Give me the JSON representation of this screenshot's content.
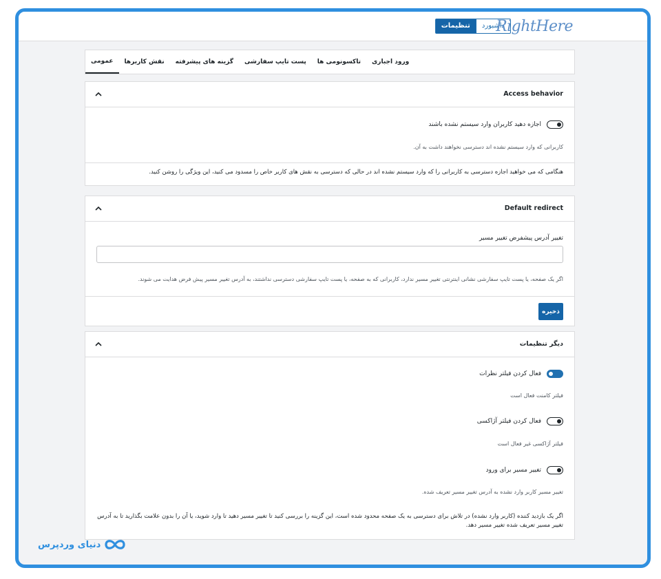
{
  "header": {
    "brand": "RightHere",
    "buttons": [
      {
        "label": "تنظیمات",
        "active": true
      },
      {
        "label": "داشبورد",
        "active": false
      }
    ]
  },
  "tabs": [
    {
      "label": "عمومی",
      "active": true
    },
    {
      "label": "نقش کاربرها",
      "active": false
    },
    {
      "label": "گزینه های پیشرفته",
      "active": false
    },
    {
      "label": "پست تایپ سفارشی",
      "active": false
    },
    {
      "label": "تاکسونومی ها",
      "active": false
    },
    {
      "label": "ورود اجباری",
      "active": false
    }
  ],
  "access_behavior": {
    "title": "Access behavior",
    "toggle_label": "اجازه دهید کاربران وارد سیستم نشده باشند",
    "toggle_on": false,
    "description": "کاربرانی که وارد سیستم نشده اند دسترسی نخواهند داشت به آن.",
    "note": "هنگامی که می خواهید اجازه دسترسی به کاربرانی را که وارد سیستم نشده اند در حالی که دسترسی به نقش های کاربر خاص را مسدود می کنید، این ویژگی را روشن کنید."
  },
  "default_redirect": {
    "title": "Default redirect",
    "field_label": "تغییر آدرس پیشفرض تغییر مسیر",
    "field_value": "",
    "note": "اگر یک صفحه، یا پست تایپ سفارشی نشانی اینترنتی تغییر مسیر ندارد، کاربرانی که به صفحه، یا پست تایپ سفارشی دسترسی نداشتند، به آدرس تغییر مسیر پیش فرض هدایت می شوند.",
    "save_label": "ذخیره"
  },
  "other_settings": {
    "title": "دیگر تنظیمات",
    "items": [
      {
        "label": "فعال کردن فیلتر نظرات",
        "on": true,
        "description": "فیلتر کامنت فعال است"
      },
      {
        "label": "فعال کردن فیلتر آژاکسی",
        "on": false,
        "description": "فیلتر آژاکسی غیر فعال است"
      },
      {
        "label": "تغییر مسیر برای ورود",
        "on": false,
        "description": "تغییر مسیر کاربر وارد نشده به آدرس تغییر مسیر تعریف شده."
      }
    ],
    "note": "اگر یک بازدید کننده (کاربر وارد نشده) در تلاش برای دسترسی به یک صفحه محدود شده است، این گزینه را بررسی کنید تا تغییر مسیر دهید تا وارد شوید، یا آن را بدون علامت بگذارید تا به آدرس تغییر مسیر تعریف شده تغییر مسیر دهد."
  },
  "watermark": {
    "text": "دنیای وردپرس",
    "color": "#2f8fdf"
  }
}
